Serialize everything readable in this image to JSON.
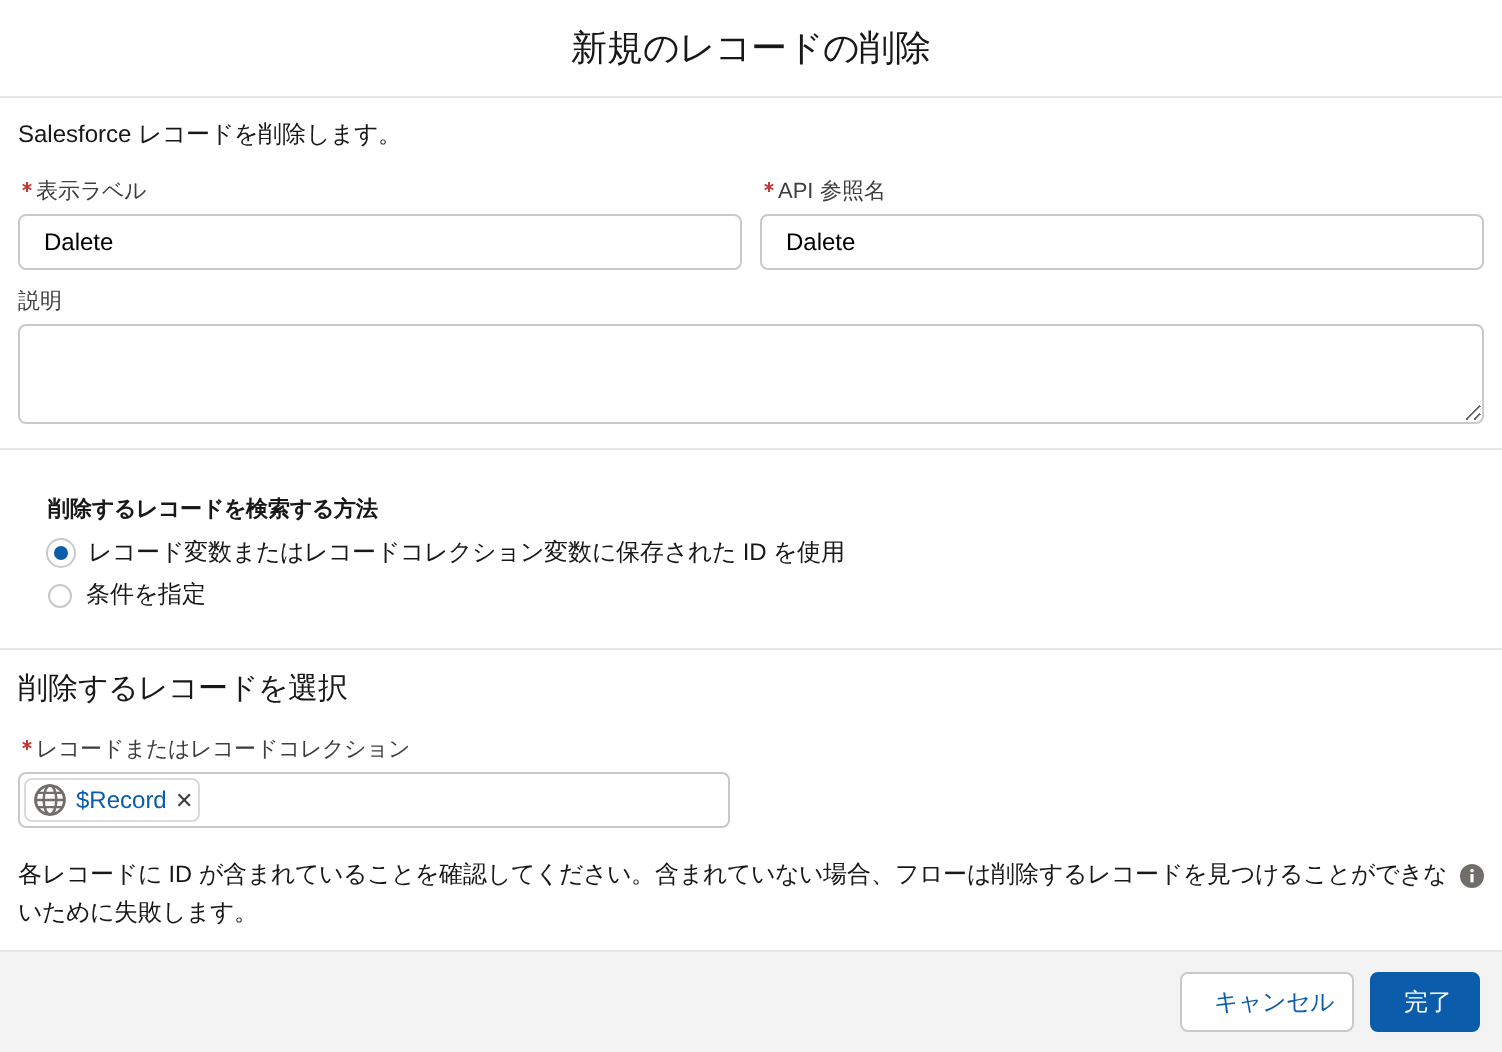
{
  "window": {
    "title": "新規のレコードの削除"
  },
  "description": "Salesforce レコードを削除します。",
  "fields": [
    {
      "label": "表示ラベル",
      "required": true,
      "value": "Dalete"
    },
    {
      "label": "API 参照名",
      "required": true,
      "value": "Dalete"
    }
  ],
  "notes_field": {
    "label": "説明"
  },
  "find_method": {
    "label": "削除するレコードを検索する方法",
    "options": [
      {
        "label": "レコード変数またはレコードコレクション変数に保存された ID を使用",
        "selected": true
      },
      {
        "label": "条件を指定",
        "selected": false
      }
    ]
  },
  "select_section": {
    "title": "削除するレコードを選択",
    "field": {
      "label": "レコードまたはレコードコレクション",
      "required": true,
      "pill": "$Record",
      "remove": "✕"
    },
    "help": "各レコードに ID が含まれていることを確認してください。含まれていない場合、フローは削除するレコードを見つけることができないために失敗します。"
  },
  "buttons": [
    {
      "label": "キャンセル",
      "kind": "neutral"
    },
    {
      "label": "完了",
      "kind": "brand"
    }
  ]
}
